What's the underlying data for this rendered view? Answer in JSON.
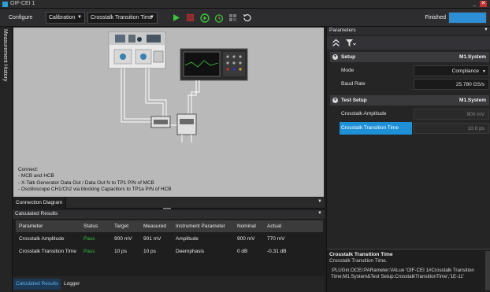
{
  "window": {
    "title": "OIF-CEI 1"
  },
  "toolbar": {
    "configure": "Configure",
    "mode_dropdown": "Calibration",
    "measurement_dropdown": "Crosstalk Transition Time",
    "status": "Finished",
    "progress": 1.0,
    "icons": [
      "play-icon",
      "stop-icon",
      "step-run-icon",
      "timer-icon",
      "grid-icon",
      "reset-icon"
    ]
  },
  "sidebar": {
    "measurement_history": "Measurement History"
  },
  "diagram": {
    "connect_title": "Connect:",
    "lines": [
      "- MCB and HCB",
      "- X-Talk Generator Data Out / Data Out N  to TP1 P/N of MCB",
      "- Oscilloscope CH1/Ch2 via blocking Capacitors to TP1a P/N of HCB"
    ],
    "tab": "Connection Diagram"
  },
  "results": {
    "title": "Calculated Results",
    "columns": [
      "Parameter",
      "Status",
      "Target",
      "Measured",
      "Instrument Parameter",
      "Nominal",
      "Actual"
    ],
    "rows": [
      [
        "Crosstalk Amplitude",
        "Pass",
        "900 mV",
        "901 mV",
        "Amplitude",
        "900 mV",
        "770 mV"
      ],
      [
        "Crosstalk Transition Time",
        "Pass",
        "10 ps",
        "10 ps",
        "Deemphasis",
        "0 dB",
        "-0.31 dB"
      ]
    ]
  },
  "bottom_tabs": [
    "Calculated Results",
    "Logger"
  ],
  "parameters": {
    "title": "Parameters",
    "setup": {
      "name": "Setup",
      "value": "M1.System",
      "mode_label": "Mode",
      "mode_value": "Compliance",
      "baud_label": "Baud Rate",
      "baud_value": "25.780 GS/s"
    },
    "test_setup": {
      "name": "Test Setup",
      "value": "M1.System",
      "amp_label": "Crosstalk Amplitude",
      "amp_value": "900 mV",
      "tt_label": "Crosstalk Transition Time",
      "tt_value": "10.0 ps"
    },
    "description": {
      "title": "Crosstalk Transition Time",
      "subtitle": "Crosstalk Transition Time.",
      "command": ":PLUGin:OCEI:PARameter:VALue 'OIF-CEI 1#Crosstalk Transition Time:M1.System&Test Setup.CrosstalkTransitionTime','1E-11'"
    }
  },
  "colors": {
    "accent": "#1e90d6",
    "pass": "#35c23c",
    "canvas": "#b9b9b9"
  }
}
